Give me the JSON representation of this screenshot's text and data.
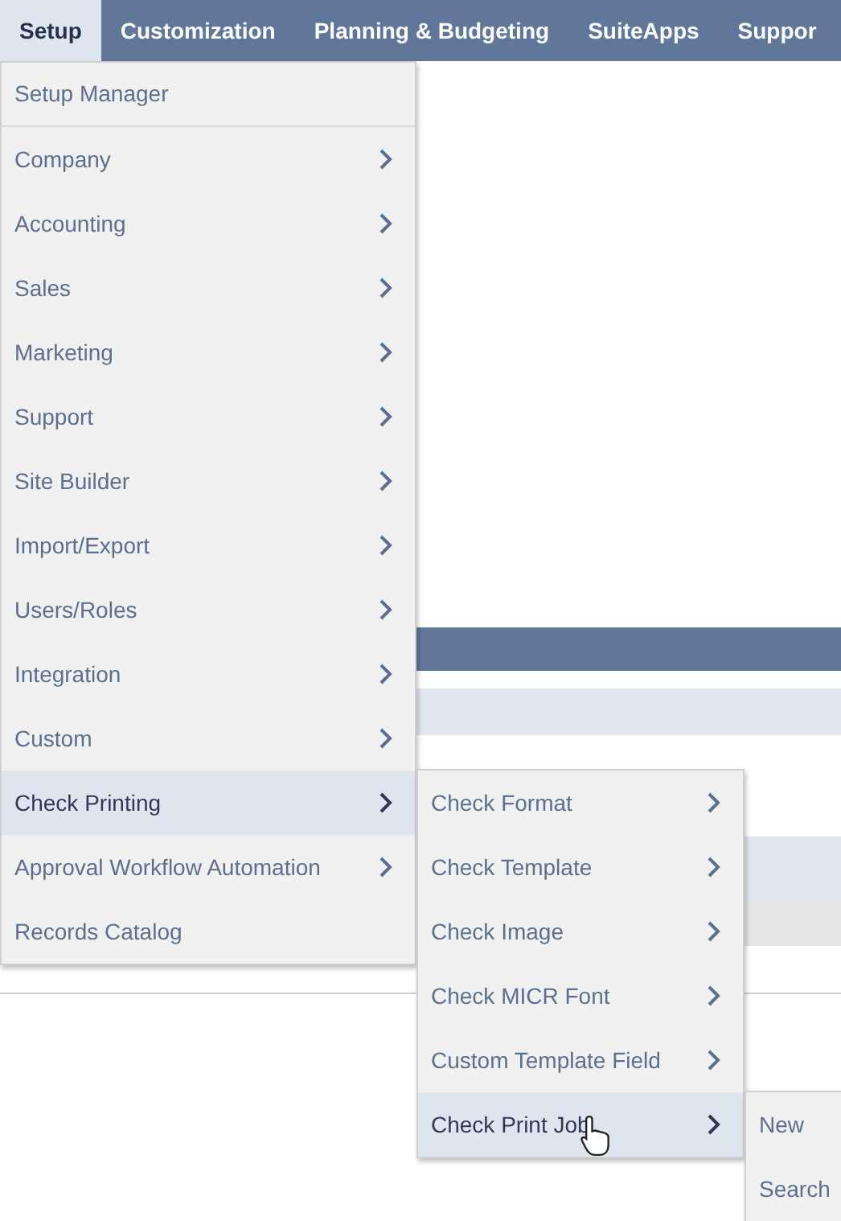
{
  "nav": {
    "tabs": [
      {
        "label": "Setup",
        "selected": true
      },
      {
        "label": "Customization",
        "selected": false
      },
      {
        "label": "Planning & Budgeting",
        "selected": false
      },
      {
        "label": "SuiteApps",
        "selected": false
      },
      {
        "label": "Suppor",
        "selected": false
      }
    ]
  },
  "menu": {
    "items": [
      {
        "label": "Setup Manager",
        "has_submenu": false,
        "selected": false,
        "separator": true
      },
      {
        "label": "Company",
        "has_submenu": true,
        "selected": false
      },
      {
        "label": "Accounting",
        "has_submenu": true,
        "selected": false
      },
      {
        "label": "Sales",
        "has_submenu": true,
        "selected": false
      },
      {
        "label": "Marketing",
        "has_submenu": true,
        "selected": false
      },
      {
        "label": "Support",
        "has_submenu": true,
        "selected": false
      },
      {
        "label": "Site Builder",
        "has_submenu": true,
        "selected": false
      },
      {
        "label": "Import/Export",
        "has_submenu": true,
        "selected": false
      },
      {
        "label": "Users/Roles",
        "has_submenu": true,
        "selected": false
      },
      {
        "label": "Integration",
        "has_submenu": true,
        "selected": false
      },
      {
        "label": "Custom",
        "has_submenu": true,
        "selected": false
      },
      {
        "label": "Check Printing",
        "has_submenu": true,
        "selected": true,
        "children": [
          {
            "label": "Check Format",
            "has_submenu": true,
            "selected": false
          },
          {
            "label": "Check Template",
            "has_submenu": true,
            "selected": false
          },
          {
            "label": "Check Image",
            "has_submenu": true,
            "selected": false
          },
          {
            "label": "Check MICR Font",
            "has_submenu": true,
            "selected": false
          },
          {
            "label": "Custom Template Field",
            "has_submenu": true,
            "selected": false
          },
          {
            "label": "Check Print Job",
            "has_submenu": true,
            "selected": true,
            "children": [
              {
                "label": "New",
                "selected": false
              },
              {
                "label": "Search",
                "selected": false
              }
            ]
          }
        ]
      },
      {
        "label": "Approval Workflow Automation",
        "has_submenu": true,
        "selected": false
      },
      {
        "label": "Records Catalog",
        "has_submenu": false,
        "selected": false
      }
    ]
  }
}
